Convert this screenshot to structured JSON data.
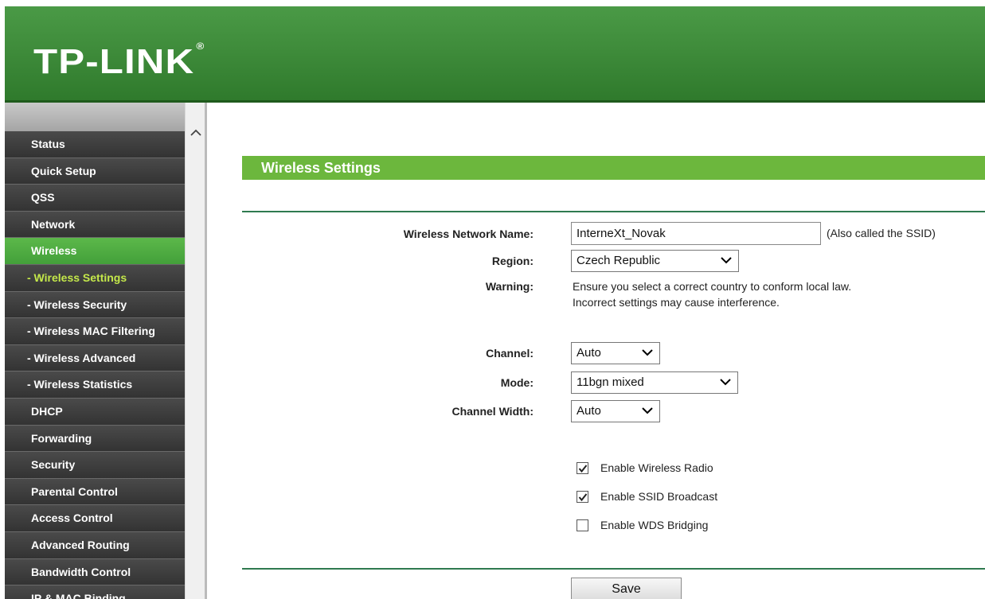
{
  "header": {
    "logo_text": "TP-LINK",
    "logo_reg": "®"
  },
  "sidebar": {
    "items": [
      {
        "label": "Status"
      },
      {
        "label": "Quick Setup"
      },
      {
        "label": "QSS"
      },
      {
        "label": "Network"
      },
      {
        "label": "Wireless"
      },
      {
        "label": "- Wireless Settings"
      },
      {
        "label": "- Wireless Security"
      },
      {
        "label": "- Wireless MAC Filtering"
      },
      {
        "label": "- Wireless Advanced"
      },
      {
        "label": "- Wireless Statistics"
      },
      {
        "label": "DHCP"
      },
      {
        "label": "Forwarding"
      },
      {
        "label": "Security"
      },
      {
        "label": "Parental Control"
      },
      {
        "label": "Access Control"
      },
      {
        "label": "Advanced Routing"
      },
      {
        "label": "Bandwidth Control"
      },
      {
        "label": "IP & MAC Binding"
      }
    ],
    "active": "Wireless",
    "active_sub": "- Wireless Settings",
    "scroll_up_icon": "chevron-up-icon"
  },
  "main": {
    "section_title": "Wireless Settings",
    "form": {
      "ssid_label": "Wireless Network Name:",
      "ssid_value": "InterneXt_Novak",
      "ssid_note": "(Also called the SSID)",
      "region_label": "Region:",
      "region_value": "Czech Republic",
      "warning_label": "Warning:",
      "warning_line1": "Ensure you select a correct country to conform local law.",
      "warning_line2": "Incorrect settings may cause interference.",
      "channel_label": "Channel:",
      "channel_value": "Auto",
      "mode_label": "Mode:",
      "mode_value": "11bgn mixed",
      "width_label": "Channel Width:",
      "width_value": "Auto",
      "checkboxes": [
        {
          "label": "Enable Wireless Radio",
          "checked": true
        },
        {
          "label": "Enable SSID Broadcast",
          "checked": true
        },
        {
          "label": "Enable WDS Bridging",
          "checked": false
        }
      ],
      "save_label": "Save"
    }
  },
  "colors": {
    "header_green": "#3f8c3b",
    "section_green": "#6cb73d",
    "menu_dark": "#3d3d3d",
    "active_sub_text": "#c4e84a"
  }
}
